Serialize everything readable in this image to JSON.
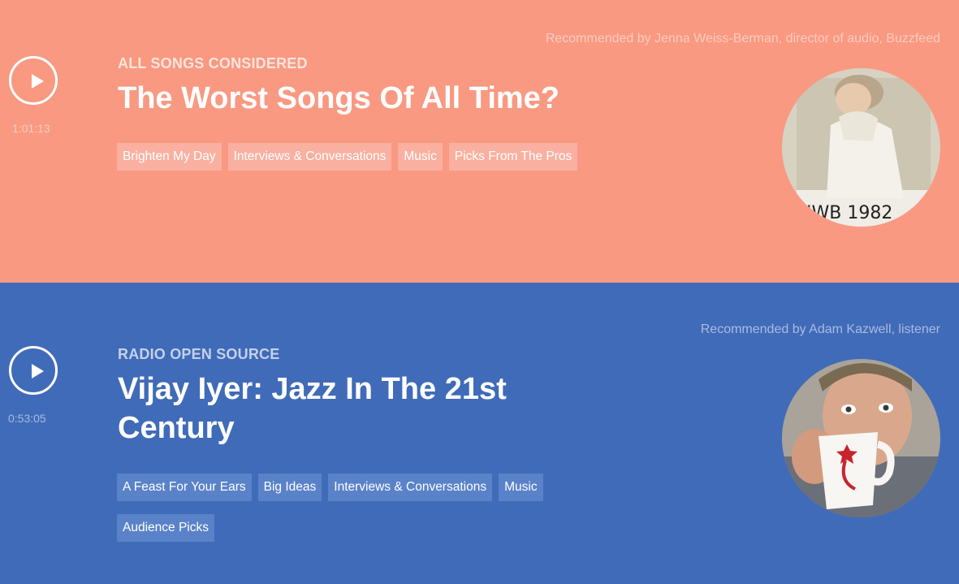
{
  "cards": [
    {
      "recommended_by": "Recommended by Jenna Weiss-Berman, director of audio, Buzzfeed",
      "duration": "1:01:13",
      "show": "ALL SONGS CONSIDERED",
      "title": "The Worst Songs Of All Time?",
      "tags": [
        "Brighten My Day",
        "Interviews & Conversations",
        "Music",
        "Picks From The Pros"
      ],
      "photo_caption": "JWB 1982",
      "play_icon": "play-icon",
      "background": "#f99982"
    },
    {
      "recommended_by": "Recommended by Adam Kazwell, listener",
      "duration": "0:53:05",
      "show": "RADIO OPEN SOURCE",
      "title": "Vijay Iyer: Jazz In The 21st Century",
      "tags": [
        "A Feast For Your Ears",
        "Big Ideas",
        "Interviews & Conversations",
        "Music",
        "Audience Picks"
      ],
      "play_icon": "play-icon",
      "background": "#406bb8"
    }
  ]
}
